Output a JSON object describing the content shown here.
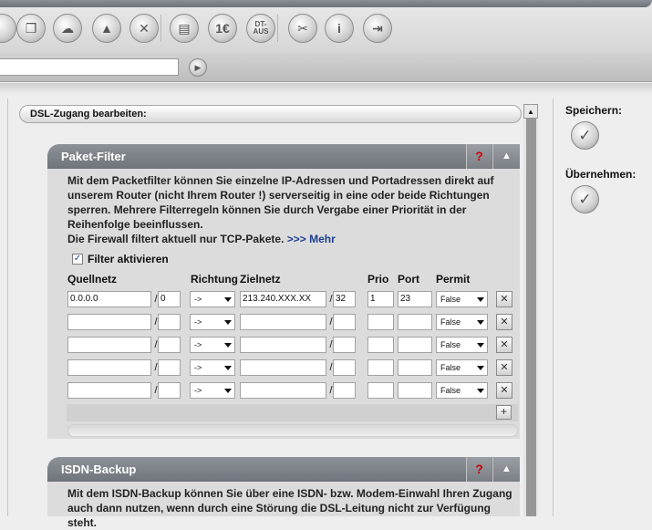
{
  "toolbar": {
    "buttons": [
      {
        "name": "nav-button-1-icon",
        "glyph": ""
      },
      {
        "name": "box-icon",
        "glyph": "❒"
      },
      {
        "name": "network-icon",
        "glyph": "☁"
      },
      {
        "name": "pyramid-icon",
        "glyph": "▲"
      },
      {
        "name": "dsl-tools-icon",
        "glyph": "✕"
      },
      {
        "name": "document-icon",
        "glyph": "▤"
      },
      {
        "name": "invoice-icon",
        "glyph": "1€"
      },
      {
        "name": "dt-aus-icon",
        "glyph": "DT-\nAUS"
      },
      {
        "name": "tools-icon",
        "glyph": "✂"
      },
      {
        "name": "info-icon",
        "glyph": "i"
      },
      {
        "name": "logout-icon",
        "glyph": "⇥"
      }
    ]
  },
  "address": {
    "value": ""
  },
  "page": {
    "title": "DSL-Zugang bearbeiten:"
  },
  "paketfilter": {
    "title": "Paket-Filter",
    "help": "?",
    "description": "Mit dem Packetfilter können Sie einzelne IP-Adressen und Portadressen direkt auf unserem Router (nicht Ihrem Router !) serverseitig in eine oder beide Richtungen sperren. Mehrere Filterregeln können Sie durch Vergabe einer Priorität in der Reihenfolge beeinflussen.",
    "description2": "Die Firewall filtert aktuell nur TCP-Pakete.",
    "more_link": ">>> Mehr",
    "filter_checked": true,
    "filter_label": "Filter aktivieren",
    "columns": {
      "quellnetz": "Quellnetz",
      "richtung": "Richtung",
      "zielnetz": "Zielnetz",
      "prio": "Prio",
      "port": "Port",
      "permit": "Permit"
    },
    "rows": [
      {
        "quellnetz": "0.0.0.0",
        "quellmask": "0",
        "richtung": "->",
        "zielnetz": "213.240.XXX.XX",
        "zielmask": "32",
        "prio": "1",
        "port": "23",
        "permit": "False"
      },
      {
        "quellnetz": "",
        "quellmask": "",
        "richtung": "->",
        "zielnetz": "",
        "zielmask": "",
        "prio": "",
        "port": "",
        "permit": "False"
      },
      {
        "quellnetz": "",
        "quellmask": "",
        "richtung": "->",
        "zielnetz": "",
        "zielmask": "",
        "prio": "",
        "port": "",
        "permit": "False"
      },
      {
        "quellnetz": "",
        "quellmask": "",
        "richtung": "->",
        "zielnetz": "",
        "zielmask": "",
        "prio": "",
        "port": "",
        "permit": "False"
      },
      {
        "quellnetz": "",
        "quellmask": "",
        "richtung": "->",
        "zielnetz": "",
        "zielmask": "",
        "prio": "",
        "port": "",
        "permit": "False"
      }
    ],
    "slash": "/",
    "delete_glyph": "✕",
    "add_glyph": "+"
  },
  "isdn": {
    "title": "ISDN-Backup",
    "help": "?",
    "description": "Mit dem ISDN-Backup können Sie über eine ISDN- bzw. Modem-Einwahl Ihren Zugang auch dann nutzen, wenn durch eine Störung die DSL-Leitung nicht zur Verfügung steht."
  },
  "sidebar": {
    "save_label": "Speichern:",
    "apply_label": "Übernehmen:",
    "check_glyph": "✓"
  }
}
